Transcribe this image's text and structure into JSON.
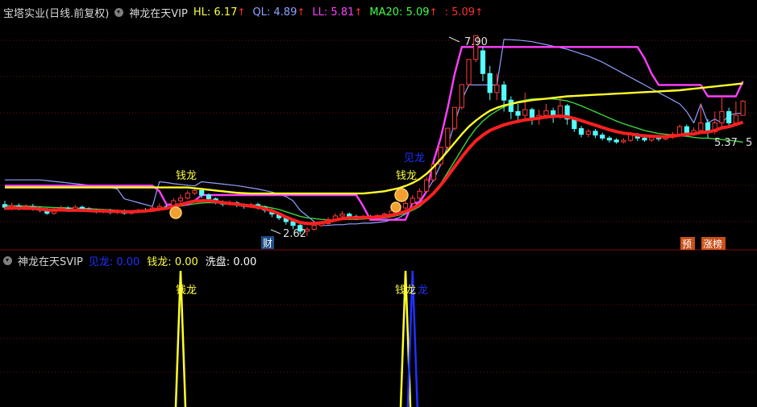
{
  "main_header": {
    "title": "宝塔实业(日线.前复权)",
    "indicator": "神龙在天VIP",
    "items": [
      {
        "label": "HL:",
        "value": "6.17",
        "arrow": "↑",
        "color": "#ffff40"
      },
      {
        "label": "QL:",
        "value": "4.89",
        "arrow": "↑",
        "color": "#8fa2ff"
      },
      {
        "label": "LL:",
        "value": "5.81",
        "arrow": "↑",
        "color": "#ff40ff"
      },
      {
        "label": "MA20:",
        "value": "5.09",
        "arrow": "↑",
        "color": "#40ff40"
      },
      {
        "label": ":",
        "value": "5.09",
        "arrow": "↑",
        "color": "#ff3030"
      }
    ]
  },
  "sub_header": {
    "indicator": "神龙在天SVIP",
    "items": [
      {
        "label": "见龙:",
        "value": "0.00",
        "color": "#2030ff"
      },
      {
        "label": "钱龙:",
        "value": "0.00",
        "color": "#ffff40"
      },
      {
        "label": "洗盘:",
        "value": "0.00",
        "color": "#ffffff"
      }
    ]
  },
  "colors": {
    "up": "#ff3c3c",
    "down": "#54ffff",
    "hl": "#ffff2a",
    "ql": "#8fa2ff",
    "ll": "#ff40ff",
    "ma20": "#3cd23c",
    "thick": "#ff2020",
    "signal_blue": "#2030ff"
  },
  "chart_data": {
    "type": "candlestick",
    "y_range": [
      2.3,
      8.2
    ],
    "candles": [
      [
        3.45,
        3.38,
        3.55,
        3.32
      ],
      [
        3.38,
        3.42,
        3.5,
        3.3
      ],
      [
        3.42,
        3.36,
        3.48,
        3.3
      ],
      [
        3.36,
        3.4,
        3.46,
        3.32
      ],
      [
        3.4,
        3.35,
        3.47,
        3.29
      ],
      [
        3.35,
        3.3,
        3.4,
        3.25
      ],
      [
        3.3,
        3.22,
        3.36,
        3.18
      ],
      [
        3.22,
        3.3,
        3.36,
        3.18
      ],
      [
        3.3,
        3.36,
        3.42,
        3.26
      ],
      [
        3.36,
        3.32,
        3.4,
        3.28
      ],
      [
        3.32,
        3.38,
        3.44,
        3.28
      ],
      [
        3.38,
        3.34,
        3.42,
        3.3
      ],
      [
        3.34,
        3.3,
        3.38,
        3.26
      ],
      [
        3.3,
        3.26,
        3.34,
        3.22
      ],
      [
        3.26,
        3.3,
        3.34,
        3.22
      ],
      [
        3.3,
        3.24,
        3.34,
        3.2
      ],
      [
        3.24,
        3.28,
        3.32,
        3.2
      ],
      [
        3.28,
        3.22,
        3.32,
        3.18
      ],
      [
        3.22,
        3.26,
        3.3,
        3.18
      ],
      [
        3.26,
        3.3,
        3.34,
        3.22
      ],
      [
        3.3,
        3.28,
        3.36,
        3.24
      ],
      [
        3.28,
        3.36,
        3.42,
        3.26
      ],
      [
        3.36,
        3.4,
        3.48,
        3.32
      ],
      [
        3.4,
        3.36,
        3.44,
        3.32
      ],
      [
        3.36,
        3.55,
        3.62,
        3.34
      ],
      [
        3.55,
        3.62,
        3.72,
        3.5
      ],
      [
        3.62,
        3.75,
        3.82,
        3.58
      ],
      [
        3.75,
        3.82,
        3.9,
        3.7
      ],
      [
        3.82,
        3.7,
        3.86,
        3.62
      ],
      [
        3.7,
        3.6,
        3.74,
        3.52
      ],
      [
        3.6,
        3.52,
        3.64,
        3.46
      ],
      [
        3.52,
        3.46,
        3.56,
        3.4
      ],
      [
        3.46,
        3.5,
        3.56,
        3.42
      ],
      [
        3.5,
        3.44,
        3.54,
        3.38
      ],
      [
        3.44,
        3.4,
        3.48,
        3.34
      ],
      [
        3.4,
        3.45,
        3.5,
        3.36
      ],
      [
        3.45,
        3.38,
        3.5,
        3.32
      ],
      [
        3.38,
        3.3,
        3.42,
        3.24
      ],
      [
        3.3,
        3.2,
        3.34,
        3.12
      ],
      [
        3.2,
        3.1,
        3.24,
        3.04
      ],
      [
        3.1,
        3.0,
        3.14,
        2.92
      ],
      [
        3.0,
        2.9,
        3.04,
        2.8
      ],
      [
        2.9,
        2.75,
        2.94,
        2.66
      ],
      [
        2.75,
        2.8,
        2.86,
        2.62
      ],
      [
        2.8,
        2.9,
        2.96,
        2.76
      ],
      [
        2.9,
        2.95,
        3.0,
        2.86
      ],
      [
        2.95,
        3.05,
        3.12,
        2.92
      ],
      [
        3.05,
        3.15,
        3.22,
        3.0
      ],
      [
        3.15,
        3.2,
        3.28,
        3.1
      ],
      [
        3.2,
        3.14,
        3.24,
        3.08
      ],
      [
        3.14,
        3.1,
        3.18,
        3.04
      ],
      [
        3.1,
        3.14,
        3.18,
        3.06
      ],
      [
        3.14,
        3.12,
        3.18,
        3.08
      ],
      [
        3.12,
        3.16,
        3.2,
        3.08
      ],
      [
        3.16,
        3.2,
        3.24,
        3.12
      ],
      [
        3.2,
        3.28,
        3.34,
        3.16
      ],
      [
        3.28,
        3.36,
        3.42,
        3.24
      ],
      [
        3.36,
        3.48,
        3.55,
        3.32
      ],
      [
        3.48,
        3.62,
        3.7,
        3.44
      ],
      [
        3.62,
        3.8,
        3.88,
        3.58
      ],
      [
        3.8,
        4.1,
        4.18,
        3.76
      ],
      [
        4.1,
        4.51,
        4.55,
        4.05
      ],
      [
        4.51,
        4.96,
        4.96,
        4.45
      ],
      [
        4.96,
        5.46,
        5.46,
        4.9
      ],
      [
        5.46,
        6.01,
        6.01,
        5.4
      ],
      [
        6.01,
        6.61,
        6.61,
        5.95
      ],
      [
        6.61,
        7.27,
        7.27,
        6.55
      ],
      [
        7.27,
        7.9,
        7.9,
        7.2
      ],
      [
        7.5,
        6.9,
        7.6,
        6.7
      ],
      [
        6.9,
        6.4,
        7.1,
        6.2
      ],
      [
        6.4,
        6.6,
        6.9,
        6.2
      ],
      [
        6.6,
        6.2,
        6.7,
        5.9
      ],
      [
        6.2,
        5.9,
        6.3,
        5.7
      ],
      [
        5.9,
        5.8,
        6.1,
        5.6
      ],
      [
        5.8,
        5.95,
        6.4,
        5.7
      ],
      [
        5.95,
        5.7,
        6.0,
        5.55
      ],
      [
        5.7,
        5.8,
        5.95,
        5.55
      ],
      [
        5.8,
        5.92,
        6.1,
        5.7
      ],
      [
        5.92,
        5.75,
        6.0,
        5.6
      ],
      [
        5.75,
        6.05,
        6.3,
        5.7
      ],
      [
        6.05,
        5.7,
        6.1,
        5.55
      ],
      [
        5.7,
        5.45,
        5.76,
        5.36
      ],
      [
        5.45,
        5.3,
        5.52,
        5.22
      ],
      [
        5.3,
        5.38,
        5.44,
        5.22
      ],
      [
        5.38,
        5.28,
        5.44,
        5.2
      ],
      [
        5.28,
        5.2,
        5.34,
        5.14
      ],
      [
        5.2,
        5.15,
        5.26,
        5.08
      ],
      [
        5.15,
        5.1,
        5.2,
        5.05
      ],
      [
        5.1,
        5.14,
        5.2,
        5.06
      ],
      [
        5.14,
        5.3,
        5.36,
        5.1
      ],
      [
        5.3,
        5.2,
        5.34,
        5.12
      ],
      [
        5.2,
        5.15,
        5.26,
        5.1
      ],
      [
        5.15,
        5.22,
        5.28,
        5.1
      ],
      [
        5.22,
        5.18,
        5.26,
        5.12
      ],
      [
        5.18,
        5.24,
        5.3,
        5.14
      ],
      [
        5.24,
        5.3,
        5.36,
        5.18
      ],
      [
        5.3,
        5.5,
        5.56,
        5.26
      ],
      [
        5.5,
        5.3,
        5.56,
        5.24
      ],
      [
        5.3,
        5.4,
        5.48,
        5.26
      ],
      [
        5.4,
        5.6,
        6.1,
        5.36
      ],
      [
        5.6,
        5.37,
        5.7,
        5.2
      ],
      [
        5.37,
        5.6,
        5.9,
        5.3
      ],
      [
        5.6,
        5.9,
        6.3,
        5.5
      ],
      [
        5.9,
        5.6,
        6.0,
        5.5
      ],
      [
        5.6,
        5.8,
        6.17,
        5.55
      ],
      [
        5.8,
        6.17,
        6.2,
        5.8
      ]
    ],
    "thick_line": [
      3.35,
      3.36,
      3.36,
      3.35,
      3.35,
      3.33,
      3.31,
      3.3,
      3.31,
      3.3,
      3.3,
      3.3,
      3.29,
      3.28,
      3.28,
      3.27,
      3.27,
      3.26,
      3.26,
      3.27,
      3.28,
      3.3,
      3.33,
      3.35,
      3.4,
      3.45,
      3.5,
      3.54,
      3.55,
      3.55,
      3.53,
      3.5,
      3.48,
      3.46,
      3.43,
      3.41,
      3.38,
      3.34,
      3.28,
      3.21,
      3.12,
      3.05,
      2.98,
      2.95,
      2.95,
      2.97,
      3.0,
      3.04,
      3.08,
      3.1,
      3.1,
      3.11,
      3.11,
      3.12,
      3.14,
      3.17,
      3.21,
      3.27,
      3.35,
      3.45,
      3.58,
      3.75,
      3.96,
      4.2,
      4.45,
      4.7,
      4.93,
      5.13,
      5.28,
      5.4,
      5.48,
      5.55,
      5.6,
      5.64,
      5.68,
      5.7,
      5.73,
      5.76,
      5.77,
      5.78,
      5.76,
      5.72,
      5.66,
      5.6,
      5.54,
      5.48,
      5.42,
      5.37,
      5.33,
      5.31,
      5.28,
      5.26,
      5.25,
      5.24,
      5.24,
      5.25,
      5.28,
      5.3,
      5.31,
      5.35,
      5.36,
      5.4,
      5.47,
      5.5,
      5.56,
      5.62
    ],
    "hl": [
      3.9,
      3.9,
      3.9,
      3.9,
      3.9,
      3.9,
      3.9,
      3.9,
      3.9,
      3.9,
      3.9,
      3.9,
      3.9,
      3.9,
      3.9,
      3.9,
      3.9,
      3.9,
      3.9,
      3.9,
      3.9,
      3.9,
      3.9,
      3.9,
      3.9,
      3.9,
      3.9,
      3.88,
      3.86,
      3.84,
      3.82,
      3.8,
      3.78,
      3.76,
      3.75,
      3.74,
      3.74,
      3.74,
      3.74,
      3.74,
      3.74,
      3.74,
      3.74,
      3.74,
      3.74,
      3.74,
      3.74,
      3.74,
      3.74,
      3.74,
      3.74,
      3.74,
      3.76,
      3.78,
      3.8,
      3.84,
      3.88,
      3.94,
      4.02,
      4.12,
      4.26,
      4.44,
      4.64,
      4.86,
      5.08,
      5.3,
      5.5,
      5.66,
      5.8,
      5.92,
      6.0,
      6.06,
      6.1,
      6.14,
      6.17,
      6.2,
      6.22,
      6.24,
      6.26,
      6.28,
      6.3,
      6.31,
      6.32,
      6.33,
      6.34,
      6.35,
      6.36,
      6.37,
      6.38,
      6.39,
      6.4,
      6.41,
      6.42,
      6.43,
      6.44,
      6.45,
      6.46,
      6.48,
      6.5,
      6.52,
      6.54,
      6.56,
      6.58,
      6.6,
      6.62,
      6.64
    ],
    "ll": [
      3.95,
      3.95,
      3.95,
      3.95,
      3.95,
      3.95,
      3.95,
      3.95,
      3.95,
      3.95,
      3.95,
      3.95,
      3.95,
      3.95,
      3.95,
      3.95,
      3.95,
      3.95,
      3.95,
      3.95,
      3.95,
      3.95,
      3.8,
      3.45,
      3.45,
      3.45,
      3.45,
      3.55,
      3.7,
      3.7,
      3.7,
      3.7,
      3.7,
      3.7,
      3.7,
      3.7,
      3.7,
      3.7,
      3.7,
      3.7,
      3.7,
      3.7,
      3.7,
      3.7,
      3.7,
      3.7,
      3.7,
      3.7,
      3.7,
      3.7,
      3.7,
      3.4,
      3.05,
      3.05,
      3.05,
      3.05,
      3.05,
      3.05,
      3.5,
      3.5,
      3.8,
      4.6,
      5.2,
      6.0,
      6.9,
      7.6,
      7.6,
      7.6,
      7.6,
      7.6,
      7.6,
      7.6,
      7.6,
      7.6,
      7.6,
      7.6,
      7.6,
      7.6,
      7.6,
      7.6,
      7.6,
      7.6,
      7.6,
      7.6,
      7.6,
      7.6,
      7.6,
      7.6,
      7.6,
      7.6,
      7.6,
      7.3,
      6.9,
      6.6,
      6.6,
      6.6,
      6.6,
      6.6,
      6.6,
      6.6,
      6.3,
      6.3,
      6.3,
      6.3,
      6.3,
      6.7
    ],
    "ql": [
      4.1,
      4.1,
      4.1,
      4.1,
      4.1,
      4.1,
      4.08,
      4.06,
      4.04,
      4.02,
      4.0,
      3.98,
      3.96,
      3.94,
      3.92,
      3.9,
      3.86,
      3.6,
      3.55,
      3.5,
      3.45,
      3.4,
      4.05,
      4.03,
      4.0,
      3.98,
      3.96,
      3.94,
      4.05,
      4.03,
      4.01,
      3.99,
      3.97,
      3.95,
      3.92,
      3.89,
      3.86,
      3.82,
      3.78,
      3.72,
      3.66,
      3.55,
      3.3,
      3.15,
      3.0,
      2.9,
      2.9,
      2.92,
      2.92,
      2.94,
      2.94,
      2.96,
      2.96,
      2.98,
      3.0,
      3.05,
      3.1,
      3.2,
      3.35,
      3.55,
      3.8,
      4.1,
      4.5,
      5.0,
      5.6,
      6.2,
      6.6,
      6.6,
      6.6,
      6.6,
      6.6,
      7.8,
      7.79,
      7.78,
      7.76,
      7.74,
      7.7,
      7.66,
      7.62,
      7.58,
      7.54,
      7.48,
      7.42,
      7.36,
      7.28,
      7.2,
      7.1,
      7.0,
      6.9,
      6.8,
      6.7,
      6.6,
      6.5,
      6.4,
      6.3,
      6.2,
      6.1,
      5.9,
      5.6,
      6.1,
      5.6,
      5.7,
      5.6,
      5.8,
      5.85,
      5.85
    ],
    "ma20": [
      3.42,
      3.42,
      3.41,
      3.41,
      3.4,
      3.39,
      3.38,
      3.37,
      3.37,
      3.36,
      3.35,
      3.35,
      3.34,
      3.33,
      3.32,
      3.31,
      3.3,
      3.29,
      3.28,
      3.28,
      3.29,
      3.31,
      3.33,
      3.35,
      3.38,
      3.41,
      3.44,
      3.47,
      3.49,
      3.5,
      3.5,
      3.49,
      3.48,
      3.47,
      3.46,
      3.44,
      3.42,
      3.4,
      3.36,
      3.32,
      3.26,
      3.2,
      3.14,
      3.1,
      3.08,
      3.06,
      3.05,
      3.05,
      3.06,
      3.06,
      3.06,
      3.07,
      3.08,
      3.09,
      3.1,
      3.13,
      3.17,
      3.22,
      3.3,
      3.4,
      3.55,
      3.75,
      4.0,
      4.3,
      4.6,
      4.9,
      5.2,
      5.45,
      5.65,
      5.8,
      5.92,
      6.02,
      6.1,
      6.16,
      6.2,
      6.23,
      6.24,
      6.24,
      6.23,
      6.21,
      6.18,
      6.12,
      6.05,
      5.97,
      5.89,
      5.81,
      5.73,
      5.65,
      5.58,
      5.52,
      5.46,
      5.4,
      5.36,
      5.32,
      5.3,
      5.28,
      5.26,
      5.25,
      5.22,
      5.2,
      5.2,
      5.18,
      5.16,
      5.14,
      5.12,
      5.09
    ],
    "sub_signals": [
      {
        "type": "钱龙",
        "index": 25
      },
      {
        "type": "钱龙",
        "index": 57
      },
      {
        "type": "见龙",
        "index": 58
      }
    ]
  },
  "annotations": {
    "high_label": "7.90",
    "low_label": "2.62",
    "low_tag": "财",
    "signal_label_1": "钱龙",
    "signal_label_2": "钱龙",
    "signal_label_blue": "见龙",
    "last_low_label": "5.37",
    "last_suffix": "5",
    "badge_1": "预",
    "badge_2": "涨榜",
    "sub_signal_label_1": "钱龙",
    "sub_signal_label_2": "钱龙",
    "sub_signal_label_3": "龙"
  }
}
